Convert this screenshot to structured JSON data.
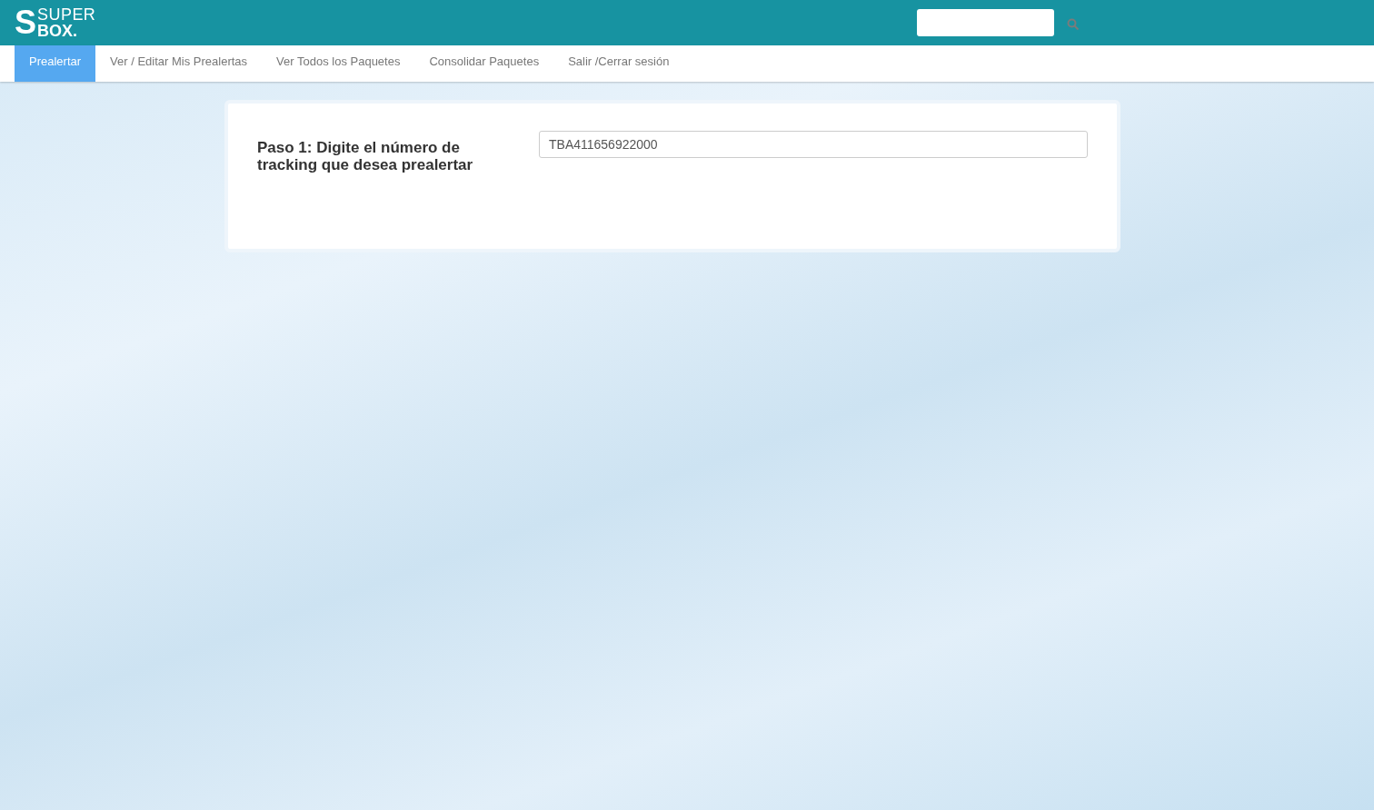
{
  "header": {
    "logo": {
      "mark": "S",
      "line_1": "SUPER",
      "line_2": "BOX."
    }
  },
  "nav": [
    {
      "label": "Prealertar",
      "selected": true
    },
    {
      "label": "Ver / Editar Mis Prealertas",
      "selected": false
    },
    {
      "label": "Ver Todos los Paquetes",
      "selected": false
    },
    {
      "label": "Consolidar Paquetes",
      "selected": false
    },
    {
      "label": "Salir /Cerrar sesión",
      "selected": false
    }
  ],
  "form": {
    "label": "Paso 1: Digite el número de tracking que desea prealertar",
    "value": "TBA411656922000"
  }
}
